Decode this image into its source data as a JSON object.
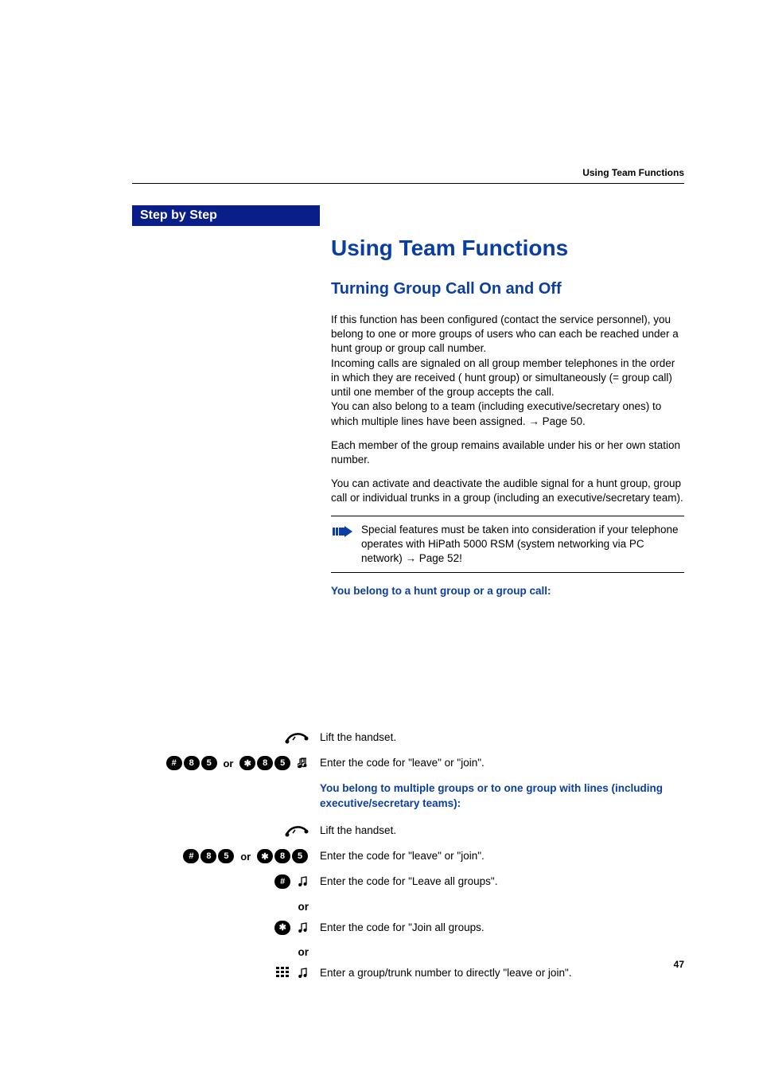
{
  "running_header": "Using Team Functions",
  "step_label": "Step by Step",
  "title": "Using Team Functions",
  "subtitle": "Turning Group Call On and Off",
  "para1a": "If this function has been configured (contact the service personnel), you belong to one or more groups of users who can each be reached under a hunt group or group call number.",
  "para1b": "Incoming calls are signaled on all group member telephones in the order in which they are received ( hunt group) or simultaneously (= group call) until one member of the group accepts the call.",
  "para1c_pre": "You can also belong to a team (including executive/secretary ones) to which multiple lines have been assigned. ",
  "para1c_link": "→ Page 50.",
  "para2": "Each member of the group remains available under his or her own station number.",
  "para3": "You can activate and deactivate the audible signal for a hunt group, group call or individual trunks in a group (including an executive/secretary team).",
  "note_pre": "Special features must be taken into consideration if your telephone operates with HiPath 5000 RSM (system networking via PC network) ",
  "note_link": "→ Page 52!",
  "blue1": "You belong to a hunt group or a group call:",
  "blue2": "You belong to multiple groups or to one group with lines (including executive/secretary teams):",
  "or": "or",
  "steps": {
    "lift": "Lift the handset.",
    "leave_join": "Enter the code for \"leave\" or \"join\".",
    "leave_all": "Enter the code for \"Leave all groups\".",
    "join_all": "Enter the code for \"Join all groups.",
    "direct": "Enter a group/trunk number to directly \"leave or join\"."
  },
  "keys": {
    "hash": "#",
    "star": "✱",
    "d8": "8",
    "d5": "5"
  },
  "page_number": "47"
}
